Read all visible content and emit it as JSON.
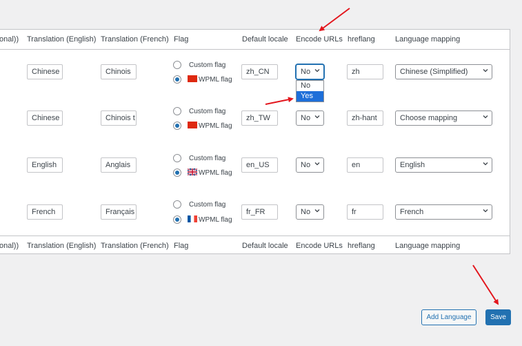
{
  "header": {
    "columns": [
      "onal))",
      "Translation (English)",
      "Translation (French)",
      "Flag",
      "Default locale",
      "Encode URLs",
      "hreflang",
      "Language mapping"
    ]
  },
  "rows": [
    {
      "translation_en": "Chinese",
      "translation_fr": "Chinois",
      "custom_flag_label": "Custom flag",
      "wpml_flag_label": "WPML flag",
      "flag_icon": "china-flag-icon",
      "locale": "zh_CN",
      "encode": "No",
      "hreflang": "zh",
      "mapping": "Chinese (Simplified)"
    },
    {
      "translation_en": "Chinese",
      "translation_fr": "Chinois t",
      "custom_flag_label": "Custom flag",
      "wpml_flag_label": "WPML flag",
      "flag_icon": "china-flag-icon",
      "locale": "zh_TW",
      "encode": "No",
      "hreflang": "zh-hant",
      "mapping": "Choose mapping"
    },
    {
      "translation_en": "English",
      "translation_fr": "Anglais",
      "custom_flag_label": "Custom flag",
      "wpml_flag_label": "WPML flag",
      "flag_icon": "uk-flag-icon",
      "locale": "en_US",
      "encode": "No",
      "hreflang": "en",
      "mapping": "English"
    },
    {
      "translation_en": "French",
      "translation_fr": "Français",
      "custom_flag_label": "Custom flag",
      "wpml_flag_label": "WPML flag",
      "flag_icon": "france-flag-icon",
      "locale": "fr_FR",
      "encode": "No",
      "hreflang": "fr",
      "mapping": "French"
    }
  ],
  "encode_dropdown": {
    "options": [
      "No",
      "Yes"
    ],
    "highlighted": "Yes"
  },
  "buttons": {
    "add_language": "Add Language",
    "save": "Save"
  },
  "annotations": {
    "arrow_color": "#e3161d"
  }
}
